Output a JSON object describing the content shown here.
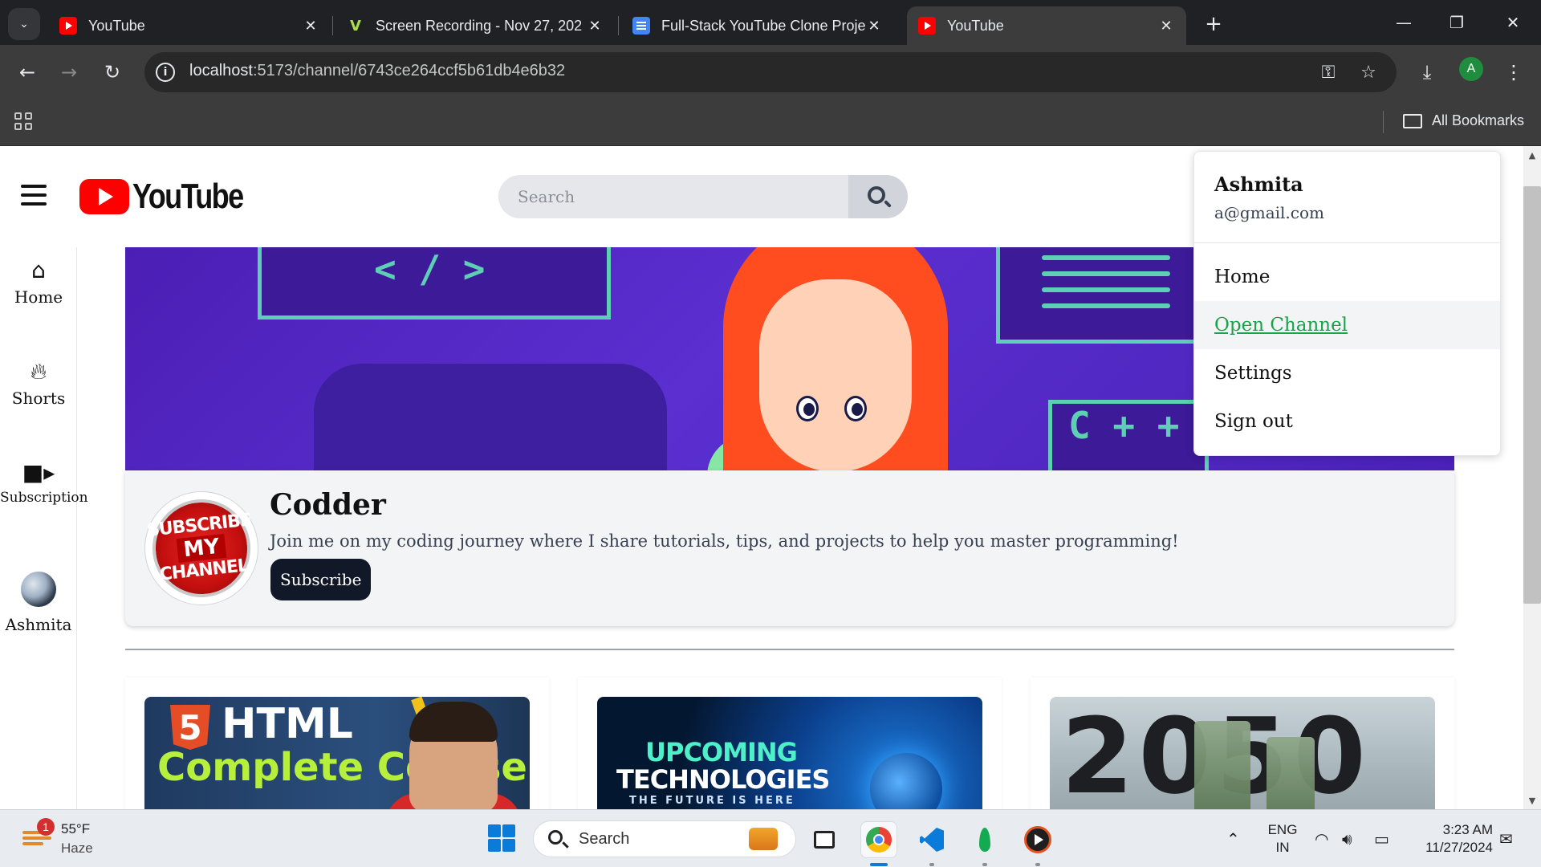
{
  "browser": {
    "tabs": [
      {
        "title": "YouTube",
        "favicon": "youtube-favicon",
        "active": false
      },
      {
        "title": "Screen Recording - Nov 27, 202",
        "favicon": "vimeo-favicon",
        "active": false
      },
      {
        "title": "Full-Stack YouTube Clone Proje",
        "favicon": "docs-favicon",
        "active": false
      },
      {
        "title": "YouTube",
        "favicon": "youtube-favicon",
        "active": true
      }
    ],
    "url_host": "localhost",
    "url_path": ":5173/channel/6743ce264ccf5b61db4e6b32",
    "profile_initial": "A",
    "bookmarks_label": "All Bookmarks"
  },
  "header": {
    "logo_text": "YouTube",
    "search_placeholder": "Search"
  },
  "sidebar": {
    "items": [
      {
        "label": "Home",
        "icon": "home-icon"
      },
      {
        "label": "Shorts",
        "icon": "fire-icon"
      },
      {
        "label": "Subscription",
        "icon": "video-camera-icon"
      },
      {
        "label": "Ashmita",
        "icon": "avatar"
      }
    ]
  },
  "banner": {
    "code_text": "< / >",
    "cpp_text": "C + +"
  },
  "channel": {
    "name": "Codder",
    "description": "Join me on my coding journey where I share tutorials, tips, and projects to help you master programming!",
    "subscribe_label": "Subscribe",
    "avatar_text": [
      "SUBSCRIBE",
      "MY",
      "CHANNEL"
    ]
  },
  "videos": [
    {
      "thumb_badge": "5",
      "thumb_title": "HTML",
      "thumb_subtitle": "Complete Course"
    },
    {
      "thumb_title": "UPCOMING",
      "thumb_subtitle": "TECHNOLOGIES",
      "thumb_tagline": "THE FUTURE IS HERE"
    },
    {
      "thumb_title": "2050"
    }
  ],
  "dropdown": {
    "user_name": "Ashmita",
    "user_email": "a@gmail.com",
    "items": [
      {
        "label": "Home",
        "hovered": false
      },
      {
        "label": "Open Channel",
        "hovered": true
      },
      {
        "label": "Settings",
        "hovered": false
      },
      {
        "label": "Sign out",
        "hovered": false
      }
    ]
  },
  "taskbar": {
    "weather_temp": "55°F",
    "weather_condition": "Haze",
    "weather_badge": "1",
    "search_label": "Search",
    "lang_1": "ENG",
    "lang_2": "IN",
    "time": "3:23 AM",
    "date": "11/27/2024"
  },
  "colors": {
    "youtube_red": "#ff0000",
    "link_hover_green": "#16a34a",
    "subscribe_bg": "#111827",
    "banner_purple": "#4b1fb5"
  }
}
